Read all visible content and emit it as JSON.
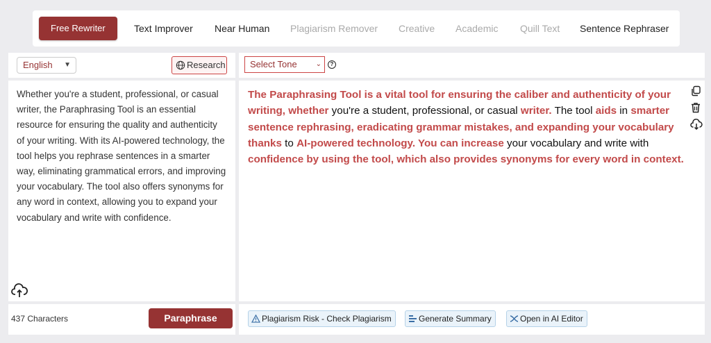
{
  "tabs": [
    {
      "label": "Free Rewriter",
      "state": "active"
    },
    {
      "label": "Text Improver",
      "state": "normal"
    },
    {
      "label": "Near Human",
      "state": "normal"
    },
    {
      "label": "Plagiarism Remover",
      "state": "disabled"
    },
    {
      "label": "Creative",
      "state": "disabled"
    },
    {
      "label": "Academic",
      "state": "disabled"
    },
    {
      "label": "Quill Text",
      "state": "disabled"
    },
    {
      "label": "Sentence Rephraser",
      "state": "normal"
    }
  ],
  "input_panel": {
    "language": "English",
    "research_label": "Research",
    "text": "Whether you're a student, professional, or casual writer, the Paraphrasing Tool is an essential resource for ensuring the quality and authenticity of your writing. With its AI-powered technology, the tool helps you rephrase sentences in a smarter way, eliminating grammatical errors, and improving your vocabulary. The tool also offers synonyms for any word in context, allowing you to expand your vocabulary and write with confidence.",
    "char_count": "437 Characters",
    "paraphrase_label": "Paraphrase"
  },
  "output_panel": {
    "tone_label": "Select Tone",
    "segments": [
      {
        "text": "The Paraphrasing Tool is a vital tool for ensuring the caliber and authenticity of your writing, whether",
        "changed": true
      },
      {
        "text": " you're a student, professional, or casual ",
        "changed": false
      },
      {
        "text": "writer.",
        "changed": true
      },
      {
        "text": " The tool ",
        "changed": false
      },
      {
        "text": "aids",
        "changed": true
      },
      {
        "text": " in ",
        "changed": false
      },
      {
        "text": "smarter sentence rephrasing, eradicating grammar mistakes, and expanding your vocabulary thanks",
        "changed": true
      },
      {
        "text": " to ",
        "changed": false
      },
      {
        "text": "AI-powered technology. You can increase",
        "changed": true
      },
      {
        "text": " your vocabulary and write with ",
        "changed": false
      },
      {
        "text": "confidence by using the tool, which also provides synonyms for every word in context.",
        "changed": true
      }
    ],
    "actions": {
      "plagiarism": "Plagiarism Risk - Check Plagiarism",
      "summary": "Generate Summary",
      "editor": "Open in AI Editor"
    }
  },
  "colors": {
    "accent": "#963333",
    "highlight": "#c24a4a",
    "background": "#ececef"
  }
}
